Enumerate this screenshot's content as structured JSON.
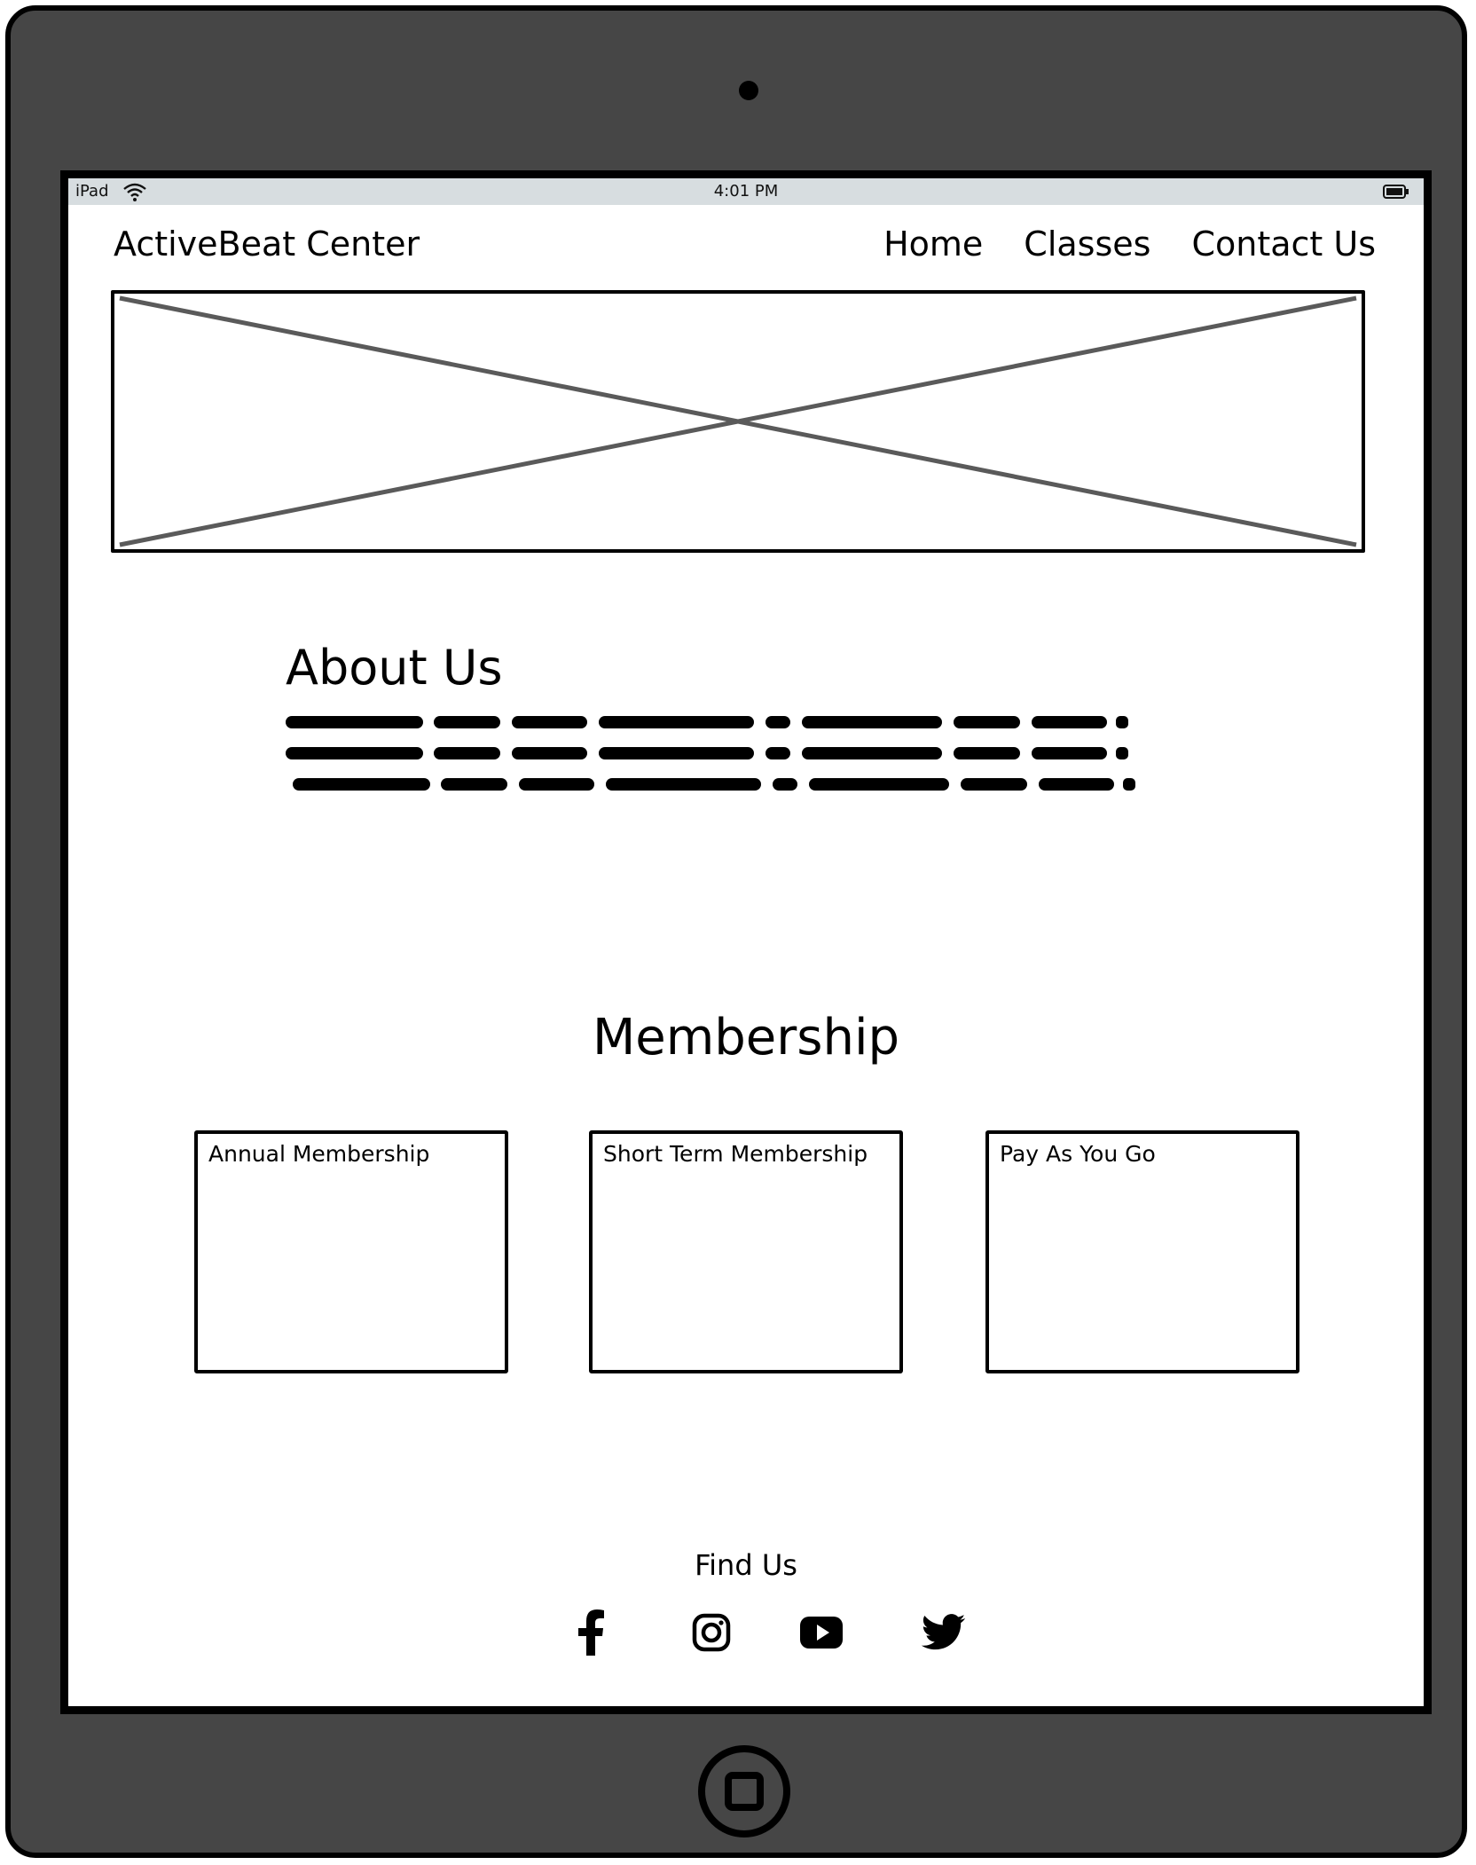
{
  "status_bar": {
    "device": "iPad",
    "time": "4:01 PM"
  },
  "header": {
    "brand": "ActiveBeat Center",
    "nav": [
      "Home",
      "Classes",
      "Contact Us"
    ]
  },
  "about": {
    "title": "About Us"
  },
  "membership": {
    "title": "Membership",
    "cards": [
      "Annual Membership",
      "Short Term Membership",
      "Pay As You Go"
    ]
  },
  "footer": {
    "title": "Find Us",
    "social_icons": [
      "facebook-icon",
      "instagram-icon",
      "youtube-icon",
      "twitter-icon"
    ]
  },
  "colors": {
    "device_frame": "#464646",
    "status_bar": "#d7dde0",
    "placeholder_cross": "#5a5a5a"
  }
}
